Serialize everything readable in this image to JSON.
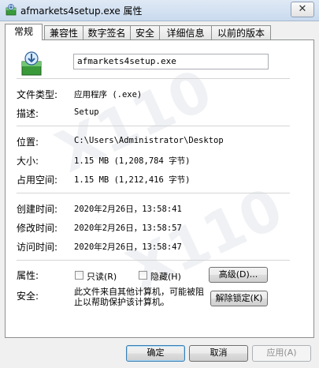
{
  "window": {
    "title": "afmarkets4setup.exe 属性",
    "close_label": "✕"
  },
  "tabs": [
    {
      "label": "常规",
      "active": true
    },
    {
      "label": "兼容性"
    },
    {
      "label": "数字签名"
    },
    {
      "label": "安全"
    },
    {
      "label": "详细信息"
    },
    {
      "label": "以前的版本"
    }
  ],
  "general": {
    "file_name": "afmarkets4setup.exe",
    "file_type_label": "文件类型:",
    "file_type_value": "应用程序 (.exe)",
    "description_label": "描述:",
    "description_value": "Setup",
    "location_label": "位置:",
    "location_value": "C:\\Users\\Administrator\\Desktop",
    "size_label": "大小:",
    "size_value": "1.15 MB (1,208,784 字节)",
    "size_on_disk_label": "占用空间:",
    "size_on_disk_value": "1.15 MB (1,212,416 字节)",
    "created_label": "创建时间:",
    "created_value": "2020年2月26日，13:58:41",
    "modified_label": "修改时间:",
    "modified_value": "2020年2月26日，13:58:57",
    "accessed_label": "访问时间:",
    "accessed_value": "2020年2月26日，13:58:47",
    "attributes_label": "属性:",
    "readonly_label": "只读(R)",
    "hidden_label": "隐藏(H)",
    "advanced_button": "高级(D)...",
    "security_label": "安全:",
    "security_text": "此文件来自其他计算机，可能被阻止以帮助保护该计算机。",
    "unblock_button": "解除锁定(K)"
  },
  "footer": {
    "ok": "确定",
    "cancel": "取消",
    "apply": "应用(A)"
  },
  "icons": {
    "title": "installer-icon",
    "app": "installer-icon"
  }
}
